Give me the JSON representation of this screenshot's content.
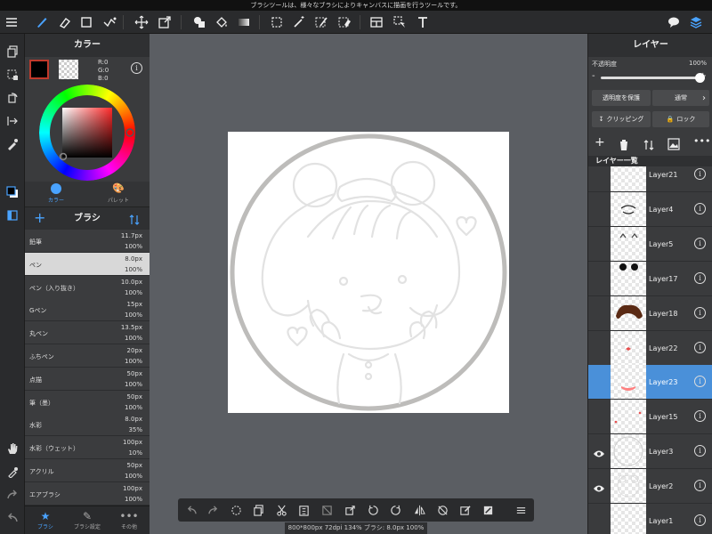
{
  "hint": "ブラシツールは、様々なブラシによりキャンバスに描画を行うツールです。",
  "color_panel": {
    "title": "カラー",
    "rgb": {
      "r": "R:0",
      "g": "G:0",
      "b": "B:0"
    },
    "tab_color": "カラー",
    "tab_palette": "パレット",
    "primary_color": "#000000",
    "hue_color": "#ff2a2a"
  },
  "brush_panel": {
    "title": "ブラシ",
    "brushes": [
      {
        "name": "鉛筆",
        "size": "11.7px",
        "opacity": "100%"
      },
      {
        "name": "ペン",
        "size": "8.0px",
        "opacity": "100%"
      },
      {
        "name": "ペン（入り抜き）",
        "size": "10.0px",
        "opacity": "100%"
      },
      {
        "name": "Gペン",
        "size": "15px",
        "opacity": "100%"
      },
      {
        "name": "丸ペン",
        "size": "13.5px",
        "opacity": "100%"
      },
      {
        "name": "ふちペン",
        "size": "20px",
        "opacity": "100%"
      },
      {
        "name": "点描",
        "size": "50px",
        "opacity": "100%"
      },
      {
        "name": "筆（墨）",
        "size": "50px",
        "opacity": "100%"
      },
      {
        "name": "水彩",
        "size": "8.0px",
        "opacity": "35%"
      },
      {
        "name": "水彩（ウェット）",
        "size": "100px",
        "opacity": "10%"
      },
      {
        "name": "アクリル",
        "size": "50px",
        "opacity": "100%"
      },
      {
        "name": "エアブラシ",
        "size": "100px",
        "opacity": "100%"
      }
    ]
  },
  "bottom_tabs": {
    "brush": "ブラシ",
    "brush_settings": "ブラシ設定",
    "other": "その他"
  },
  "layer_panel": {
    "title": "レイヤー",
    "opacity_label": "不透明度",
    "opacity_value": "100%",
    "minus": "-",
    "plus": "+",
    "protect_alpha": "透明度を保護",
    "blend_mode": "通常",
    "clipping": "クリッピング",
    "lock": "ロック",
    "list_title": "レイヤー一覧",
    "layers": [
      {
        "name": "Layer21",
        "visible": false
      },
      {
        "name": "Layer4",
        "visible": false
      },
      {
        "name": "Layer5",
        "visible": false
      },
      {
        "name": "Layer17",
        "visible": false
      },
      {
        "name": "Layer18",
        "visible": false
      },
      {
        "name": "Layer22",
        "visible": false
      },
      {
        "name": "Layer23",
        "visible": false
      },
      {
        "name": "Layer15",
        "visible": false
      },
      {
        "name": "Layer3",
        "visible": true
      },
      {
        "name": "Layer2",
        "visible": true
      },
      {
        "name": "Layer1",
        "visible": false
      }
    ],
    "selected": "Layer23",
    "accent": "#4a90d9"
  },
  "status": "800*800px 72dpi 134% ブラシ: 8.0px 100%",
  "info_symbol": "i"
}
